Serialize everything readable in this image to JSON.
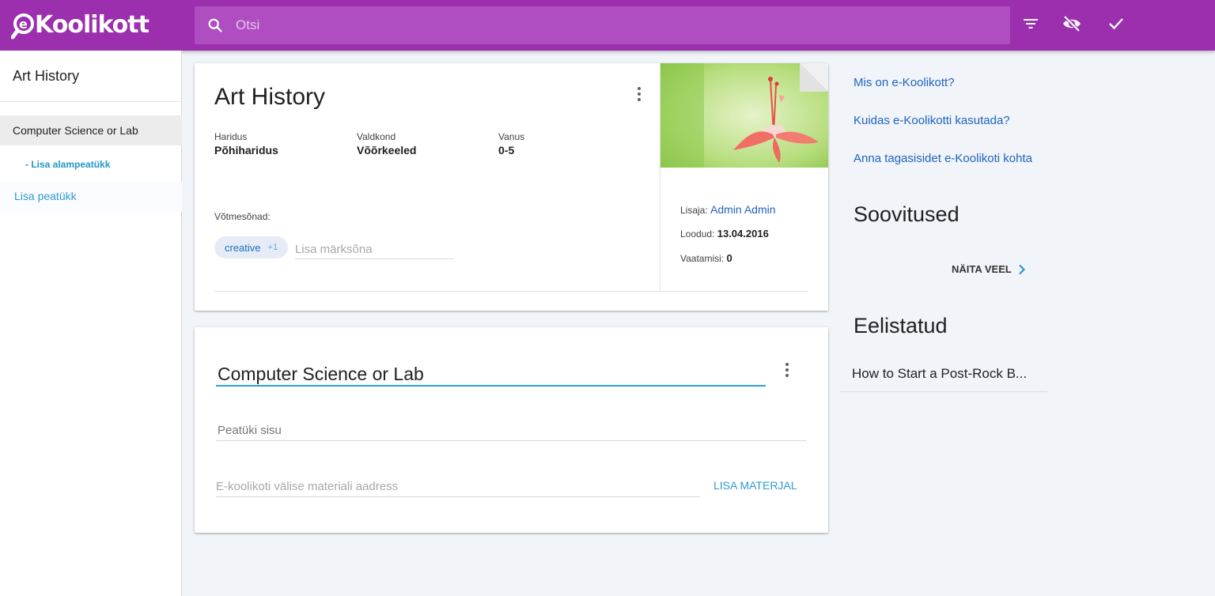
{
  "brand": {
    "logo_text": "Koolikott",
    "logo_prefix": "e"
  },
  "colors": {
    "topbar": "#9b2fae",
    "accent": "#2b9ad1",
    "link": "#1e63c0"
  },
  "search": {
    "placeholder": "Otsi"
  },
  "toolbar": {
    "icons": [
      "filter-icon",
      "visibility-off-icon",
      "check-icon"
    ]
  },
  "sidebar": {
    "title": "Art History",
    "chapter": "Computer Science or Lab",
    "add_subchapter": "- Lisa alampeatükk",
    "add_chapter": "Lisa peatükk"
  },
  "material": {
    "title": "Art History",
    "meta": [
      {
        "label": "Haridus",
        "value": "Põhiharidus"
      },
      {
        "label": "Valdkond",
        "value": "Võõrkeeled"
      },
      {
        "label": "Vanus",
        "value": "0-5"
      }
    ],
    "keywords_label": "Võtmesõnad:",
    "keyword_chip": "creative",
    "keyword_more": "+1",
    "keyword_placeholder": "Lisa märksõna",
    "author_label": "Lisaja:",
    "author": "Admin Admin",
    "created_label": "Loodud:",
    "created": "13.04.2016",
    "views_label": "Vaatamisi:",
    "views": "0"
  },
  "chapter": {
    "title": "Computer Science or Lab",
    "content_placeholder": "Peatüki sisu",
    "url_placeholder": "E-koolikoti välise materiali aadress",
    "add_material": "LISA MATERJAL"
  },
  "right": {
    "links": [
      "Mis on e-Koolikott?",
      "Kuidas e-Koolikotti kasutada?",
      "Anna tagasisidet e-Koolikoti kohta"
    ],
    "recommendations_heading": "Soovitused",
    "show_more": "NÄITA VEEL",
    "favorites_heading": "Eelistatud",
    "favorite_item": "How to Start a Post-Rock B..."
  }
}
